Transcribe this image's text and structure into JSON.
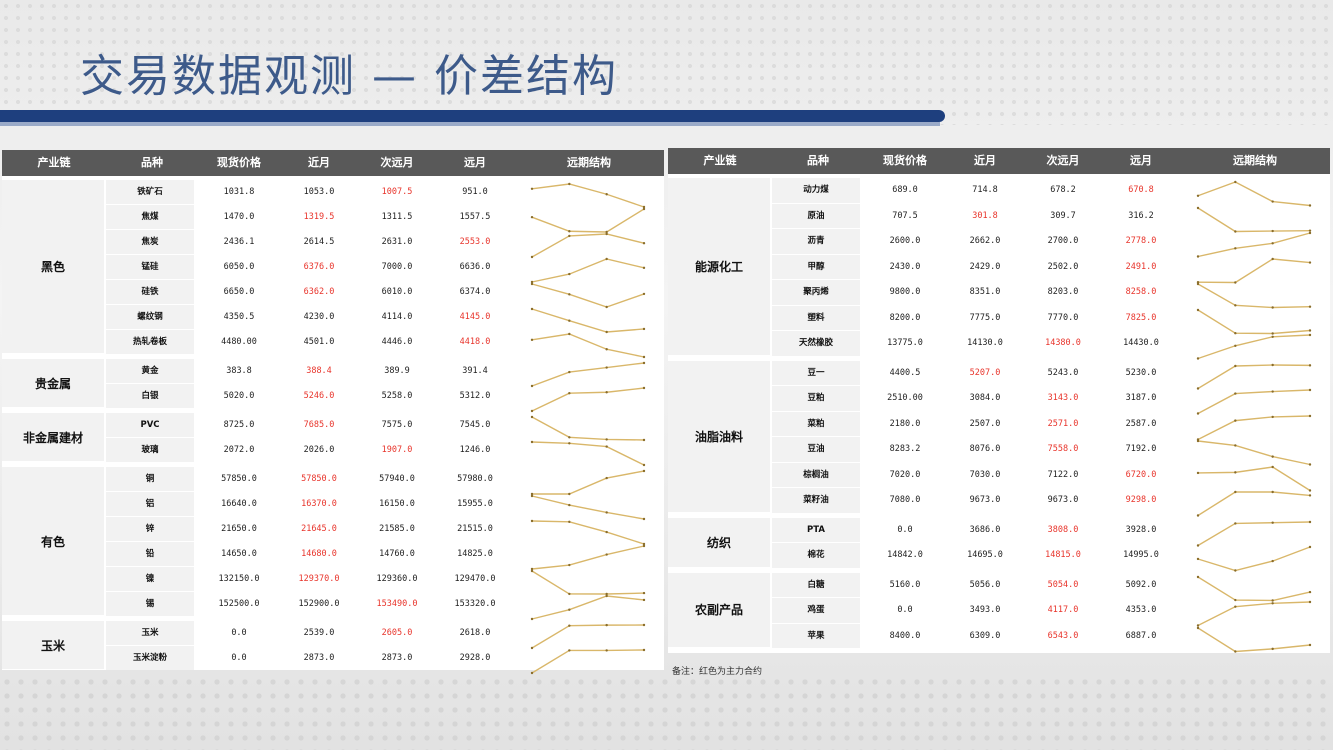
{
  "title": "交易数据观测 — 价差结构",
  "headers": [
    "产业链",
    "品种",
    "现货价格",
    "近月",
    "次远月",
    "远月",
    "远期结构"
  ],
  "note": "备注：红色为主力合约",
  "colors": {
    "accent": "#1e3f7e",
    "title": "#3d5a8a",
    "header_bg": "#595959",
    "red": "#e8342b",
    "line": "#d9b76a"
  },
  "left_groups": [
    {
      "name": "黑色",
      "rows": [
        {
          "name": "铁矿石",
          "values": [
            "1031.8",
            "1053.0",
            "1007.5",
            "951.0"
          ],
          "red": 2
        },
        {
          "name": "焦煤",
          "values": [
            "1470.0",
            "1319.5",
            "1311.5",
            "1557.5"
          ],
          "red": 1
        },
        {
          "name": "焦炭",
          "values": [
            "2436.1",
            "2614.5",
            "2631.0",
            "2553.0"
          ],
          "red": 3
        },
        {
          "name": "锰硅",
          "values": [
            "6050.0",
            "6376.0",
            "7000.0",
            "6636.0"
          ],
          "red": 1
        },
        {
          "name": "硅铁",
          "values": [
            "6650.0",
            "6362.0",
            "6010.0",
            "6374.0"
          ],
          "red": 1
        },
        {
          "name": "螺纹钢",
          "values": [
            "4350.5",
            "4230.0",
            "4114.0",
            "4145.0"
          ],
          "red": 3
        },
        {
          "name": "热轧卷板",
          "values": [
            "4480.00",
            "4501.0",
            "4446.0",
            "4418.0"
          ],
          "red": 3
        }
      ]
    },
    {
      "name": "贵金属",
      "rows": [
        {
          "name": "黄金",
          "values": [
            "383.8",
            "388.4",
            "389.9",
            "391.4"
          ],
          "red": 1
        },
        {
          "name": "白银",
          "values": [
            "5020.0",
            "5246.0",
            "5258.0",
            "5312.0"
          ],
          "red": 1
        }
      ]
    },
    {
      "name": "非金属建材",
      "rows": [
        {
          "name": "PVC",
          "values": [
            "8725.0",
            "7685.0",
            "7575.0",
            "7545.0"
          ],
          "red": 1
        },
        {
          "name": "玻璃",
          "values": [
            "2072.0",
            "2026.0",
            "1907.0",
            "1246.0"
          ],
          "red": 2
        }
      ]
    },
    {
      "name": "有色",
      "rows": [
        {
          "name": "铜",
          "values": [
            "57850.0",
            "57850.0",
            "57940.0",
            "57980.0"
          ],
          "red": 1
        },
        {
          "name": "铝",
          "values": [
            "16640.0",
            "16370.0",
            "16150.0",
            "15955.0"
          ],
          "red": 1
        },
        {
          "name": "锌",
          "values": [
            "21650.0",
            "21645.0",
            "21585.0",
            "21515.0"
          ],
          "red": 1
        },
        {
          "name": "铅",
          "values": [
            "14650.0",
            "14680.0",
            "14760.0",
            "14825.0"
          ],
          "red": 1
        },
        {
          "name": "镍",
          "values": [
            "132150.0",
            "129370.0",
            "129360.0",
            "129470.0"
          ],
          "red": 1
        },
        {
          "name": "锡",
          "values": [
            "152500.0",
            "152900.0",
            "153490.0",
            "153320.0"
          ],
          "red": 2
        }
      ]
    },
    {
      "name": "玉米",
      "rows": [
        {
          "name": "玉米",
          "values": [
            "0.0",
            "2539.0",
            "2605.0",
            "2618.0"
          ],
          "red": 2
        },
        {
          "name": "玉米淀粉",
          "values": [
            "0.0",
            "2873.0",
            "2873.0",
            "2928.0"
          ],
          "red": -1
        }
      ]
    }
  ],
  "right_groups": [
    {
      "name": "能源化工",
      "rows": [
        {
          "name": "动力煤",
          "values": [
            "689.0",
            "714.8",
            "678.2",
            "670.8"
          ],
          "red": 3
        },
        {
          "name": "原油",
          "values": [
            "707.5",
            "301.8",
            "309.7",
            "316.2"
          ],
          "red": 1
        },
        {
          "name": "沥青",
          "values": [
            "2600.0",
            "2662.0",
            "2700.0",
            "2778.0"
          ],
          "red": 3
        },
        {
          "name": "甲醇",
          "values": [
            "2430.0",
            "2429.0",
            "2502.0",
            "2491.0"
          ],
          "red": 3
        },
        {
          "name": "聚丙烯",
          "values": [
            "9800.0",
            "8351.0",
            "8203.0",
            "8258.0"
          ],
          "red": 3
        },
        {
          "name": "塑料",
          "values": [
            "8200.0",
            "7775.0",
            "7770.0",
            "7825.0"
          ],
          "red": 3
        },
        {
          "name": "天然橡胶",
          "values": [
            "13775.0",
            "14130.0",
            "14380.0",
            "14430.0"
          ],
          "red": 2
        }
      ]
    },
    {
      "name": "油脂油料",
      "rows": [
        {
          "name": "豆一",
          "values": [
            "4400.5",
            "5207.0",
            "5243.0",
            "5230.0"
          ],
          "red": 1
        },
        {
          "name": "豆粕",
          "values": [
            "2510.00",
            "3084.0",
            "3143.0",
            "3187.0"
          ],
          "red": 2
        },
        {
          "name": "菜粕",
          "values": [
            "2180.0",
            "2507.0",
            "2571.0",
            "2587.0"
          ],
          "red": 2
        },
        {
          "name": "豆油",
          "values": [
            "8283.2",
            "8076.0",
            "7558.0",
            "7192.0"
          ],
          "red": 2
        },
        {
          "name": "棕榈油",
          "values": [
            "7020.0",
            "7030.0",
            "7122.0",
            "6720.0"
          ],
          "red": 3
        },
        {
          "name": "菜籽油",
          "values": [
            "7080.0",
            "9673.0",
            "9673.0",
            "9298.0"
          ],
          "red": 3
        }
      ]
    },
    {
      "name": "纺织",
      "rows": [
        {
          "name": "PTA",
          "values": [
            "0.0",
            "3686.0",
            "3808.0",
            "3928.0"
          ],
          "red": 2
        },
        {
          "name": "棉花",
          "values": [
            "14842.0",
            "14695.0",
            "14815.0",
            "14995.0"
          ],
          "red": 2
        }
      ]
    },
    {
      "name": "农副产品",
      "rows": [
        {
          "name": "白糖",
          "values": [
            "5160.0",
            "5056.0",
            "5054.0",
            "5092.0"
          ],
          "red": 2
        },
        {
          "name": "鸡蛋",
          "values": [
            "0.0",
            "3493.0",
            "4117.0",
            "4353.0"
          ],
          "red": 2
        },
        {
          "name": "苹果",
          "values": [
            "8400.0",
            "6309.0",
            "6543.0",
            "6887.0"
          ],
          "red": 2
        }
      ]
    }
  ]
}
